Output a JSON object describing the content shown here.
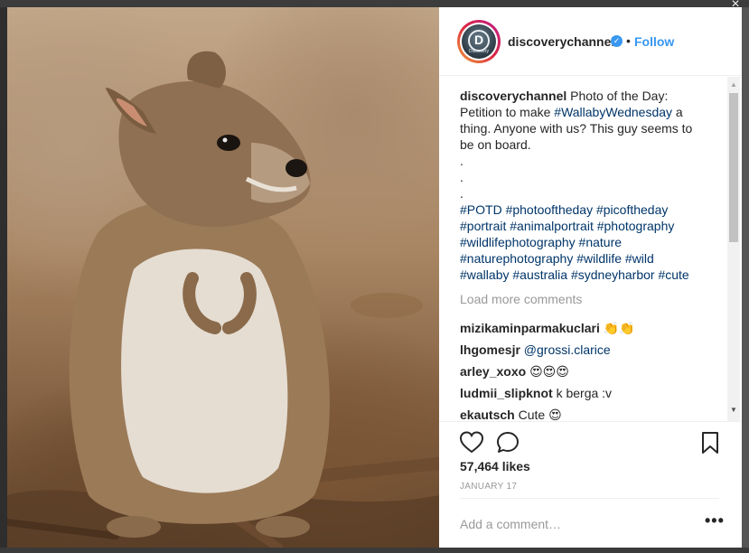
{
  "window": {
    "close_glyph": "×"
  },
  "photo": {
    "alt": "Wallaby photo",
    "icon": "wallaby-photo"
  },
  "post": {
    "username": "discoverychannel",
    "avatar_label": "Discovery",
    "verified_glyph": "✓",
    "separator": "•",
    "follow_label": "Follow",
    "caption": {
      "user": "discoverychannel",
      "text_before": " Photo of the Day: Petition to make ",
      "hashtag": "#WallabyWednesday",
      "text_after": " a thing. Anyone with us? This guy seems to be on board.",
      "dots": [
        ".",
        ".",
        "."
      ],
      "hashtags": "#POTD #photooftheday #picoftheday #portrait #animalportrait #photography #wildlifephotography #nature #naturephotography #wildlife #wild #wallaby #australia #sydneyharbor #cute"
    },
    "load_more": "Load more comments",
    "comments": [
      {
        "user": "mizikaminparmakuclari",
        "text": "",
        "emoji": "👏👏"
      },
      {
        "user": "lhgomesjr",
        "text": "@grossi.clarice",
        "emoji": ""
      },
      {
        "user": "arley_xoxo",
        "text": "",
        "emoji": "😍😍😍"
      },
      {
        "user": "ludmii_slipknot",
        "text": "k berga :v",
        "emoji": ""
      },
      {
        "user": "ekautsch",
        "text": "Cute",
        "emoji": "😍"
      }
    ],
    "likes": "57,464 likes",
    "date": "JANUARY 17",
    "add_comment_placeholder": "Add a comment…",
    "more_glyph": "•••"
  },
  "colors": {
    "link": "#3897f0",
    "hashtag": "#003569",
    "muted": "#999999",
    "text": "#262626"
  }
}
